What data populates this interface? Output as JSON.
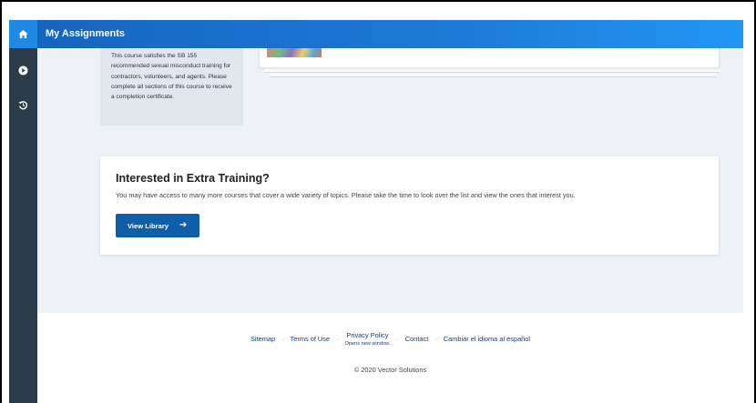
{
  "topbar": {
    "title": "My Assignments"
  },
  "rail": {
    "items": [
      {
        "icon": "home-icon",
        "active": true
      },
      {
        "icon": "play-circle-icon",
        "active": false
      },
      {
        "icon": "history-icon",
        "active": false
      }
    ]
  },
  "course_info": {
    "description": "This course satisfies the SB 155 recommended sexual misconduct training for contractors, volunteers, and agents. Please complete all sections of this course to receive a completion certificate."
  },
  "extra_training": {
    "title": "Interested in Extra Training?",
    "description": "You may have access to many more courses that cover a wide variety of topics. Please take the time to look over the list and view the ones that interest you.",
    "button_label": "View Library",
    "button_icon": "arrow-right-icon"
  },
  "footer": {
    "links": {
      "sitemap": "Sitemap",
      "terms": "Terms of Use",
      "privacy": "Privacy Policy",
      "privacy_sub": "Opens new window.",
      "contact": "Contact",
      "spanish": "Cambiar el idioma al español"
    },
    "separator": "·",
    "copyright": "© 2020 Vector Solutions"
  },
  "colors": {
    "topbar": "#1e7ad8",
    "rail": "#2b3b49",
    "rail_active": "#1e88e5",
    "button": "#0e5ea8",
    "content_bg": "#eef1f6"
  }
}
